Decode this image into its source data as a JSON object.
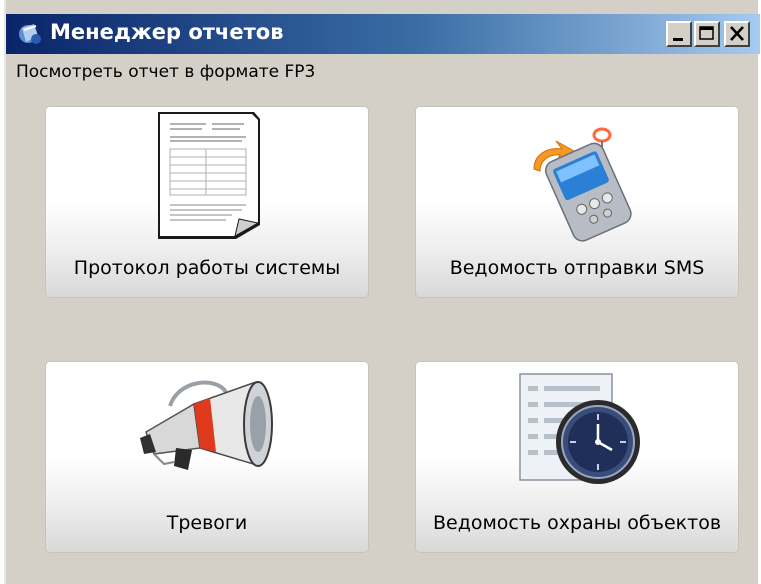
{
  "window": {
    "title": "Менеджер отчетов",
    "buttons": [
      "minimize-icon",
      "maximize-icon",
      "close-icon"
    ]
  },
  "subtitle": "Посмотреть отчет в формате FP3",
  "tiles": [
    {
      "label": "Протокол работы системы",
      "icon": "document-icon"
    },
    {
      "label": "Ведомость отправки SMS",
      "icon": "mobile-sync-icon"
    },
    {
      "label": "Тревоги",
      "icon": "megaphone-icon"
    },
    {
      "label": "Ведомость охраны объектов",
      "icon": "list-clock-icon"
    }
  ],
  "colors": {
    "titlebar_start": "#0a246a",
    "titlebar_end": "#a6caf0",
    "window_bg": "#d4d0c8"
  }
}
